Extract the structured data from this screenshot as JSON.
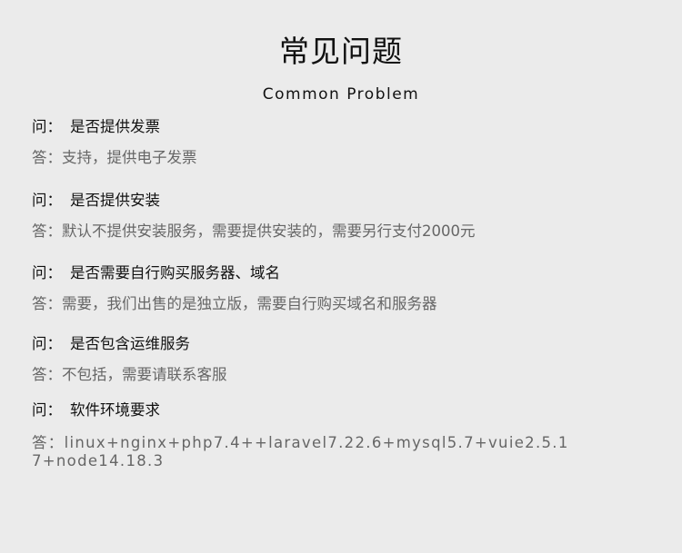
{
  "header": {
    "title": "常见问题",
    "subtitle": "Common Problem"
  },
  "faq": {
    "q_prefix": "问：",
    "a_prefix": "答：",
    "items": [
      {
        "question": "是否提供发票",
        "answer": "支持，提供电子发票"
      },
      {
        "question": "是否提供安装",
        "answer": "默认不提供安装服务，需要提供安装的，需要另行支付2000元"
      },
      {
        "question": "是否需要自行购买服务器、域名",
        "answer": "需要，我们出售的是独立版，需要自行购买域名和服务器"
      },
      {
        "question": "是否包含运维服务",
        "answer": "不包括，需要请联系客服"
      },
      {
        "question": "软件环境要求",
        "answer": "linux+nginx+php7.4++laravel7.22.6+mysql5.7+vuie2.5.17+node14.18.3"
      }
    ]
  }
}
